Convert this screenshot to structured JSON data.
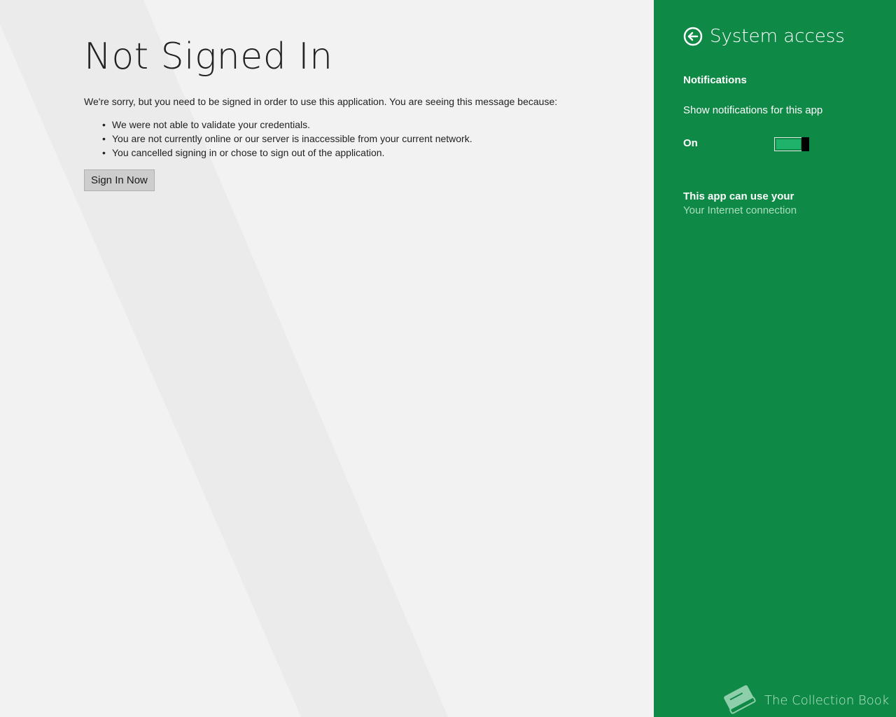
{
  "main": {
    "title": "Not Signed In",
    "message": "We're sorry, but you need to be signed in order to use this application. You are seeing this message because:",
    "reasons": [
      "We were not able to validate your credentials.",
      "You are not currently online or our server is inaccessible from your current network.",
      "You cancelled signing in or chose to sign out of the application."
    ],
    "sign_in_label": "Sign In Now"
  },
  "flyout": {
    "title": "System access",
    "back_icon": "back-arrow-circle-icon",
    "notifications": {
      "heading": "Notifications",
      "label": "Show notifications for this app",
      "state": "On",
      "enabled": true
    },
    "capabilities": {
      "heading": "This app can use your",
      "items": [
        "Your Internet connection"
      ]
    },
    "brand": {
      "name": "The Collection Book",
      "icon": "book-icon"
    }
  },
  "colors": {
    "accent": "#0f8946",
    "background": "#f2f2f2",
    "toggle_fill": "#1fb26a"
  }
}
